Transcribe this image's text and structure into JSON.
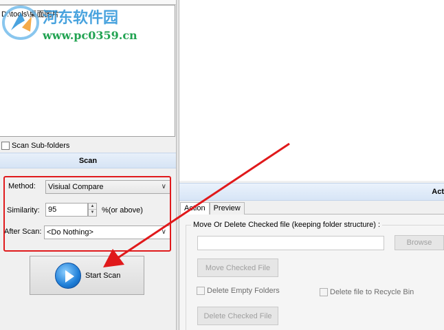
{
  "watermark": {
    "title": "河东软件园",
    "url": "www.pc0359.cn"
  },
  "folder_list": {
    "path": "D:\\tools\\桌面图片"
  },
  "scan_options": {
    "scan_subfolders_label": "Scan Sub-folders",
    "scan_subfolders_checked": false,
    "section_title": "Scan",
    "method_label": "Method:",
    "method_value": "Visiual Compare",
    "similarity_label": "Similarity:",
    "similarity_value": "95",
    "similarity_suffix": "%(or above)",
    "after_scan_label": "After Scan:",
    "after_scan_value": "<Do Nothing>",
    "start_scan_label": "Start Scan"
  },
  "action_panel": {
    "header": "Act",
    "tabs": [
      {
        "label": "Action",
        "active": true
      },
      {
        "label": "Preview",
        "active": false
      }
    ],
    "move_label": "Move Or Delete Checked file (keeping folder structure) :",
    "path_value": "",
    "browse_label": "Browse",
    "move_checked_label": "Move Checked File",
    "delete_empty_folders_label": "Delete Empty Folders",
    "delete_to_recycle_label": "Delete file to Recycle Bin",
    "delete_checked_label": "Delete Checked File"
  },
  "colors": {
    "highlight": "#e0191b",
    "accent": "#1f7fd8"
  }
}
